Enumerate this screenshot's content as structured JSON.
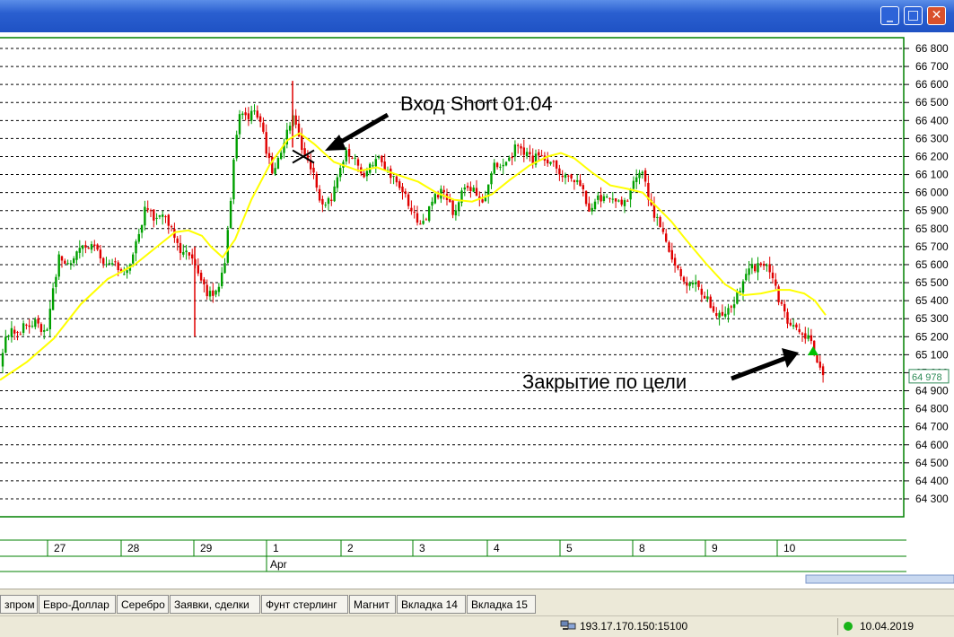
{
  "window": {
    "buttons": {
      "minimize": "_",
      "maximize": "□",
      "close": "✕"
    }
  },
  "chart_data": {
    "type": "candlestick",
    "y_ticks": [
      64300,
      64400,
      64500,
      64600,
      64700,
      64800,
      64900,
      65000,
      65100,
      65200,
      65300,
      65400,
      65500,
      65600,
      65700,
      65800,
      65900,
      66000,
      66100,
      66200,
      66300,
      66400,
      66500,
      66600,
      66700,
      66800
    ],
    "y_tick_labels": [
      "64 300",
      "64 400",
      "64 500",
      "64 600",
      "64 700",
      "64 800",
      "64 900",
      "65 000",
      "65 100",
      "65 200",
      "65 300",
      "65 400",
      "65 500",
      "65 600",
      "65 700",
      "65 800",
      "65 900",
      "66 000",
      "66 100",
      "66 200",
      "66 300",
      "66 400",
      "66 500",
      "66 600",
      "66 700",
      "66 800"
    ],
    "ylim": [
      64250,
      66850
    ],
    "grid": true,
    "current_price": "64 978",
    "x_day_labels": [
      "27",
      "28",
      "29",
      "1",
      "2",
      "3",
      "4",
      "5",
      "8",
      "9",
      "10"
    ],
    "x_month_label": "Apr",
    "close_path": [
      [
        0,
        65040
      ],
      [
        6,
        65180
      ],
      [
        12,
        65260
      ],
      [
        20,
        65220
      ],
      [
        30,
        65270
      ],
      [
        42,
        65280
      ],
      [
        52,
        65200
      ],
      [
        58,
        65450
      ],
      [
        66,
        65640
      ],
      [
        78,
        65610
      ],
      [
        90,
        65720
      ],
      [
        104,
        65690
      ],
      [
        118,
        65600
      ],
      [
        128,
        65610
      ],
      [
        138,
        65520
      ],
      [
        148,
        65650
      ],
      [
        156,
        65780
      ],
      [
        162,
        65930
      ],
      [
        170,
        65860
      ],
      [
        180,
        65900
      ],
      [
        190,
        65800
      ],
      [
        200,
        65690
      ],
      [
        212,
        65660
      ],
      [
        220,
        65550
      ],
      [
        230,
        65450
      ],
      [
        240,
        65430
      ],
      [
        250,
        65600
      ],
      [
        256,
        65900
      ],
      [
        262,
        66300
      ],
      [
        268,
        66450
      ],
      [
        274,
        66420
      ],
      [
        282,
        66440
      ],
      [
        292,
        66380
      ],
      [
        298,
        66200
      ],
      [
        305,
        66100
      ],
      [
        312,
        66200
      ],
      [
        320,
        66350
      ],
      [
        326,
        66420
      ],
      [
        334,
        66280
      ],
      [
        342,
        66180
      ],
      [
        350,
        66100
      ],
      [
        356,
        65950
      ],
      [
        362,
        65950
      ],
      [
        370,
        65980
      ],
      [
        378,
        66100
      ],
      [
        386,
        66230
      ],
      [
        396,
        66200
      ],
      [
        404,
        66100
      ],
      [
        414,
        66150
      ],
      [
        424,
        66180
      ],
      [
        434,
        66100
      ],
      [
        444,
        66050
      ],
      [
        452,
        65980
      ],
      [
        458,
        65920
      ],
      [
        466,
        65830
      ],
      [
        474,
        65850
      ],
      [
        482,
        65950
      ],
      [
        490,
        66000
      ],
      [
        498,
        65980
      ],
      [
        506,
        65880
      ],
      [
        516,
        66030
      ],
      [
        528,
        66020
      ],
      [
        540,
        65940
      ],
      [
        548,
        66140
      ],
      [
        558,
        66170
      ],
      [
        568,
        66180
      ],
      [
        576,
        66280
      ],
      [
        584,
        66220
      ],
      [
        592,
        66180
      ],
      [
        600,
        66210
      ],
      [
        608,
        66190
      ],
      [
        618,
        66150
      ],
      [
        628,
        66080
      ],
      [
        638,
        66060
      ],
      [
        648,
        66030
      ],
      [
        656,
        65910
      ],
      [
        664,
        65970
      ],
      [
        676,
        65970
      ],
      [
        690,
        65950
      ],
      [
        700,
        65960
      ],
      [
        708,
        66100
      ],
      [
        716,
        66120
      ],
      [
        724,
        65940
      ],
      [
        734,
        65820
      ],
      [
        744,
        65700
      ],
      [
        752,
        65620
      ],
      [
        762,
        65510
      ],
      [
        774,
        65500
      ],
      [
        786,
        65420
      ],
      [
        796,
        65340
      ],
      [
        806,
        65340
      ],
      [
        816,
        65380
      ],
      [
        826,
        65480
      ],
      [
        836,
        65580
      ],
      [
        846,
        65590
      ],
      [
        856,
        65600
      ],
      [
        866,
        65440
      ],
      [
        874,
        65320
      ],
      [
        882,
        65260
      ],
      [
        890,
        65240
      ],
      [
        898,
        65210
      ],
      [
        906,
        65150
      ],
      [
        912,
        65020
      ],
      [
        918,
        64978
      ]
    ],
    "ma_path": [
      [
        0,
        64960
      ],
      [
        30,
        65060
      ],
      [
        60,
        65190
      ],
      [
        90,
        65380
      ],
      [
        120,
        65520
      ],
      [
        150,
        65600
      ],
      [
        175,
        65700
      ],
      [
        195,
        65780
      ],
      [
        210,
        65790
      ],
      [
        225,
        65760
      ],
      [
        235,
        65700
      ],
      [
        248,
        65640
      ],
      [
        262,
        65740
      ],
      [
        280,
        65960
      ],
      [
        300,
        66150
      ],
      [
        320,
        66290
      ],
      [
        334,
        66330
      ],
      [
        350,
        66270
      ],
      [
        372,
        66170
      ],
      [
        400,
        66120
      ],
      [
        420,
        66140
      ],
      [
        442,
        66100
      ],
      [
        466,
        66060
      ],
      [
        486,
        66000
      ],
      [
        506,
        65960
      ],
      [
        526,
        65950
      ],
      [
        548,
        65990
      ],
      [
        568,
        66070
      ],
      [
        590,
        66150
      ],
      [
        610,
        66200
      ],
      [
        625,
        66220
      ],
      [
        640,
        66190
      ],
      [
        660,
        66110
      ],
      [
        680,
        66040
      ],
      [
        700,
        66020
      ],
      [
        716,
        66000
      ],
      [
        730,
        65930
      ],
      [
        748,
        65840
      ],
      [
        764,
        65740
      ],
      [
        786,
        65610
      ],
      [
        808,
        65490
      ],
      [
        828,
        65430
      ],
      [
        848,
        65440
      ],
      [
        866,
        65460
      ],
      [
        880,
        65460
      ],
      [
        896,
        65440
      ],
      [
        908,
        65400
      ],
      [
        920,
        65320
      ]
    ],
    "ohlc_seed": 20190410
  },
  "annotations": {
    "entry": "Вход Short 01.04",
    "exit": "Закрытие по цели"
  },
  "tabs": [
    "зпром",
    "Евро-Доллар",
    "Серебро",
    "Заявки, сделки",
    "Фунт стерлинг",
    "Магнит",
    "Вкладка 14",
    "Вкладка 15"
  ],
  "status": {
    "connection": "193.17.170.150:15100",
    "date": "10.04.2019"
  },
  "colors": {
    "grid_frame": "#008000",
    "bull": "#00a000",
    "bear": "#e00000",
    "ma": "#ffff00",
    "titlebar": "#2a5fd0"
  }
}
